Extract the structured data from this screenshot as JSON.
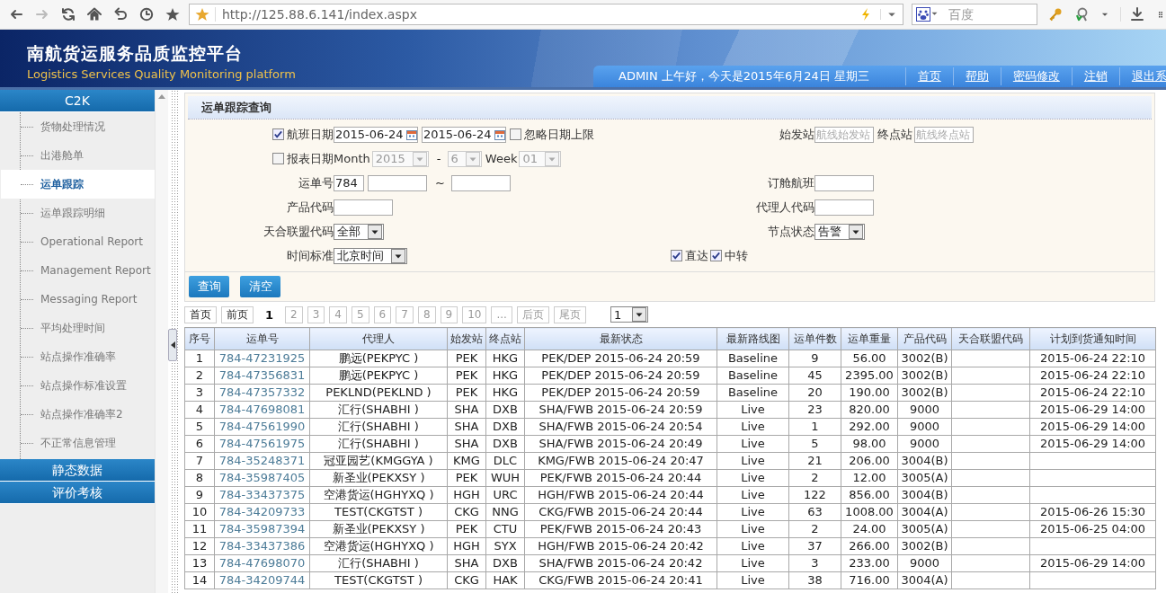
{
  "browser": {
    "address": "http://125.88.6.141/index.aspx",
    "search_placeholder": "百度"
  },
  "header": {
    "title": "南航货运服务品质监控平台",
    "subtitle": "Logistics Services Quality Monitoring platform",
    "greeting": "ADMIN 上午好，今天是2015年6月24日 星期三",
    "links": [
      "首页",
      "帮助",
      "密码修改",
      "注销",
      "退出系"
    ]
  },
  "sidebar": {
    "sections": [
      {
        "title": "C2K",
        "items": [
          {
            "label": "货物处理情况",
            "selected": false
          },
          {
            "label": "出港舱单",
            "selected": false
          },
          {
            "label": "运单跟踪",
            "selected": true
          },
          {
            "label": "运单跟踪明细",
            "selected": false
          },
          {
            "label": "Operational Report",
            "selected": false
          },
          {
            "label": "Management Report",
            "selected": false
          },
          {
            "label": "Messaging Report",
            "selected": false
          },
          {
            "label": "平均处理时间",
            "selected": false
          },
          {
            "label": "站点操作准确率",
            "selected": false
          },
          {
            "label": "站点操作标准设置",
            "selected": false
          },
          {
            "label": "站点操作准确率2",
            "selected": false
          },
          {
            "label": "不正常信息管理",
            "selected": false
          }
        ]
      },
      {
        "title": "静态数据"
      },
      {
        "title": "评价考核"
      }
    ]
  },
  "query": {
    "title": "运单跟踪查询",
    "rows": [
      {
        "cells": [
          [
            {
              "kind": "checkbox",
              "checked": true
            },
            {
              "kind": "label",
              "text": "航班日期"
            }
          ],
          [
            {
              "kind": "date",
              "value": "2015-06-24"
            },
            {
              "kind": "date",
              "value": "2015-06-24"
            },
            {
              "kind": "checkbox",
              "checked": false
            },
            {
              "kind": "label",
              "text": "忽略日期上限"
            }
          ],
          [
            {
              "kind": "label",
              "text": "始发站"
            }
          ],
          [
            {
              "kind": "input",
              "placeholder": "航线始发站"
            },
            {
              "kind": "label",
              "text": "终点站"
            },
            {
              "kind": "input",
              "placeholder": "航线终点站"
            }
          ]
        ]
      },
      {
        "cells": [
          [
            {
              "kind": "checkbox",
              "checked": false
            },
            {
              "kind": "label",
              "text": "报表日期"
            }
          ],
          [
            {
              "kind": "label",
              "text": "Month"
            },
            {
              "kind": "select",
              "value": "2015",
              "disabled": true
            },
            {
              "kind": "text",
              "text": "-"
            },
            {
              "kind": "select",
              "value": "6",
              "disabled": true
            },
            {
              "kind": "label",
              "text": "Week"
            },
            {
              "kind": "select",
              "value": "01",
              "disabled": true
            }
          ],
          [],
          []
        ]
      },
      {
        "cells": [
          [
            {
              "kind": "label",
              "text": "运单号"
            }
          ],
          [
            {
              "kind": "prefix-input",
              "value": "784"
            },
            {
              "kind": "input"
            },
            {
              "kind": "text",
              "text": "~"
            },
            {
              "kind": "input"
            }
          ],
          [
            {
              "kind": "label",
              "text": "订舱航班"
            }
          ],
          [
            {
              "kind": "input"
            }
          ]
        ]
      },
      {
        "cells": [
          [
            {
              "kind": "label",
              "text": "产品代码"
            }
          ],
          [
            {
              "kind": "input"
            }
          ],
          [
            {
              "kind": "label",
              "text": "代理人代码"
            }
          ],
          [
            {
              "kind": "input"
            }
          ]
        ]
      },
      {
        "cells": [
          [
            {
              "kind": "label",
              "text": "天合联盟代码"
            }
          ],
          [
            {
              "kind": "select",
              "value": "全部",
              "disabled": false
            }
          ],
          [
            {
              "kind": "label",
              "text": "节点状态"
            }
          ],
          [
            {
              "kind": "select",
              "value": "告警",
              "disabled": false
            }
          ]
        ]
      },
      {
        "cells": [
          [
            {
              "kind": "label",
              "text": "时间标准"
            }
          ],
          [
            {
              "kind": "select",
              "value": "北京时间",
              "disabled": false
            }
          ],
          [
            {
              "kind": "checkbox",
              "checked": true
            },
            {
              "kind": "label",
              "text": "直达"
            },
            {
              "kind": "checkbox",
              "checked": true
            },
            {
              "kind": "label",
              "text": "中转"
            }
          ],
          []
        ]
      }
    ],
    "buttons": [
      "查询",
      "清空"
    ]
  },
  "pager": {
    "items": [
      {
        "label": "首页",
        "selected": false
      },
      {
        "label": "前页",
        "selected": false
      },
      {
        "label": "1",
        "selected": true
      },
      {
        "label": "2",
        "selected": false
      },
      {
        "label": "3",
        "selected": false
      },
      {
        "label": "4",
        "selected": false
      },
      {
        "label": "5",
        "selected": false
      },
      {
        "label": "6",
        "selected": false
      },
      {
        "label": "7",
        "selected": false
      },
      {
        "label": "8",
        "selected": false
      },
      {
        "label": "9",
        "selected": false
      },
      {
        "label": "10",
        "selected": false
      },
      {
        "label": "...",
        "selected": false
      },
      {
        "label": "后页",
        "selected": false
      },
      {
        "label": "尾页",
        "selected": false
      }
    ],
    "page_select": "1"
  },
  "table": {
    "columns": [
      {
        "label": "序号",
        "kind": "text"
      },
      {
        "label": "运单号",
        "kind": "link"
      },
      {
        "label": "代理人",
        "kind": "text"
      },
      {
        "label": "始发站",
        "kind": "text"
      },
      {
        "label": "终点站",
        "kind": "text"
      },
      {
        "label": "最新状态",
        "kind": "text"
      },
      {
        "label": "最新路线图",
        "kind": "text"
      },
      {
        "label": "运单件数",
        "kind": "text"
      },
      {
        "label": "运单重量",
        "kind": "text"
      },
      {
        "label": "产品代码",
        "kind": "text"
      },
      {
        "label": "天合联盟代码",
        "kind": "text"
      },
      {
        "label": "计划到货通知时间",
        "kind": "text"
      }
    ],
    "rows": [
      [
        "1",
        "784-47231925",
        "鹏远(PEKPYC )",
        "PEK",
        "HKG",
        "PEK/DEP 2015-06-24 20:59",
        "Baseline",
        "9",
        "56.00",
        "3002(B)",
        null,
        "2015-06-24 22:10"
      ],
      [
        "2",
        "784-47356831",
        "鹏远(PEKPYC )",
        "PEK",
        "HKG",
        "PEK/DEP 2015-06-24 20:59",
        "Baseline",
        "45",
        "2395.00",
        "3002(B)",
        null,
        "2015-06-24 22:10"
      ],
      [
        "3",
        "784-47357332",
        "PEKLND(PEKLND )",
        "PEK",
        "HKG",
        "PEK/DEP 2015-06-24 20:59",
        "Baseline",
        "20",
        "190.00",
        "3002(B)",
        null,
        "2015-06-24 22:10"
      ],
      [
        "4",
        "784-47698081",
        "汇行(SHABHI )",
        "SHA",
        "DXB",
        "SHA/FWB 2015-06-24 20:59",
        "Live",
        "23",
        "820.00",
        "9000",
        null,
        "2015-06-29 14:00"
      ],
      [
        "5",
        "784-47561990",
        "汇行(SHABHI )",
        "SHA",
        "DXB",
        "SHA/FWB 2015-06-24 20:54",
        "Live",
        "1",
        "292.00",
        "9000",
        null,
        "2015-06-29 14:00"
      ],
      [
        "6",
        "784-47561975",
        "汇行(SHABHI )",
        "SHA",
        "DXB",
        "SHA/FWB 2015-06-24 20:49",
        "Live",
        "5",
        "98.00",
        "9000",
        null,
        "2015-06-29 14:00"
      ],
      [
        "7",
        "784-35248371",
        "冠亚园艺(KMGGYA )",
        "KMG",
        "DLC",
        "KMG/FWB 2015-06-24 20:47",
        "Live",
        "21",
        "206.00",
        "3004(B)",
        null,
        null
      ],
      [
        "8",
        "784-35987405",
        "新圣业(PEKXSY )",
        "PEK",
        "WUH",
        "PEK/FWB 2015-06-24 20:44",
        "Live",
        "2",
        "12.00",
        "3005(A)",
        null,
        null
      ],
      [
        "9",
        "784-33437375",
        "空港货运(HGHYXQ )",
        "HGH",
        "URC",
        "HGH/FWB 2015-06-24 20:44",
        "Live",
        "122",
        "856.00",
        "3004(B)",
        null,
        null
      ],
      [
        "10",
        "784-34209733",
        "TEST(CKGTST )",
        "CKG",
        "NNG",
        "CKG/FWB 2015-06-24 20:44",
        "Live",
        "63",
        "1008.00",
        "3004(A)",
        null,
        "2015-06-26 15:30"
      ],
      [
        "11",
        "784-35987394",
        "新圣业(PEKXSY )",
        "PEK",
        "CTU",
        "PEK/FWB 2015-06-24 20:43",
        "Live",
        "2",
        "24.00",
        "3005(A)",
        null,
        "2015-06-25 04:00"
      ],
      [
        "12",
        "784-33437386",
        "空港货运(HGHYXQ )",
        "HGH",
        "SYX",
        "HGH/FWB 2015-06-24 20:42",
        "Live",
        "37",
        "266.00",
        "3002(B)",
        null,
        null
      ],
      [
        "13",
        "784-47698070",
        "汇行(SHABHI )",
        "SHA",
        "DXB",
        "SHA/FWB 2015-06-24 20:42",
        "Live",
        "3",
        "233.00",
        "9000",
        null,
        "2015-06-29 14:00"
      ],
      [
        "14",
        "784-34209744",
        "TEST(CKGTST )",
        "CKG",
        "HAK",
        "CKG/FWB 2015-06-24 20:41",
        "Live",
        "38",
        "716.00",
        "3004(A)",
        null,
        null
      ]
    ]
  }
}
